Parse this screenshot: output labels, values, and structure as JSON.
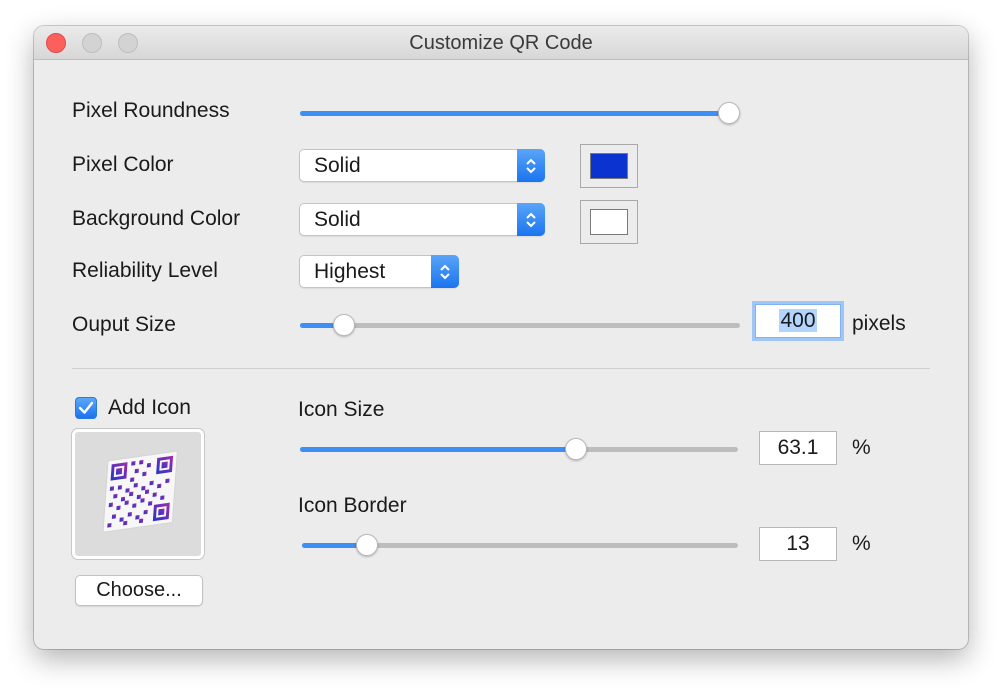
{
  "window": {
    "title": "Customize QR Code"
  },
  "settings": {
    "pixel_roundness": {
      "label": "Pixel Roundness",
      "value_fraction": 1.0
    },
    "pixel_color": {
      "label": "Pixel Color",
      "selected": "Solid",
      "color": "#0a33d0"
    },
    "background_color": {
      "label": "Background Color",
      "selected": "Solid",
      "color": "#ffffff"
    },
    "reliability_level": {
      "label": "Reliability Level",
      "selected": "Highest"
    },
    "output_size": {
      "label": "Ouput Size",
      "value": "400",
      "unit": "pixels",
      "value_fraction": 0.1
    }
  },
  "icon": {
    "add_icon_label": "Add Icon",
    "add_icon_checked": true,
    "choose_label": "Choose...",
    "icon_size": {
      "label": "Icon Size",
      "value": "63.1",
      "unit": "%",
      "value_fraction": 0.631
    },
    "icon_border": {
      "label": "Icon Border",
      "value": "13",
      "unit": "%",
      "value_fraction": 0.15
    }
  },
  "colors": {
    "accent": "#3d8ef5",
    "window_bg": "#ececec"
  }
}
